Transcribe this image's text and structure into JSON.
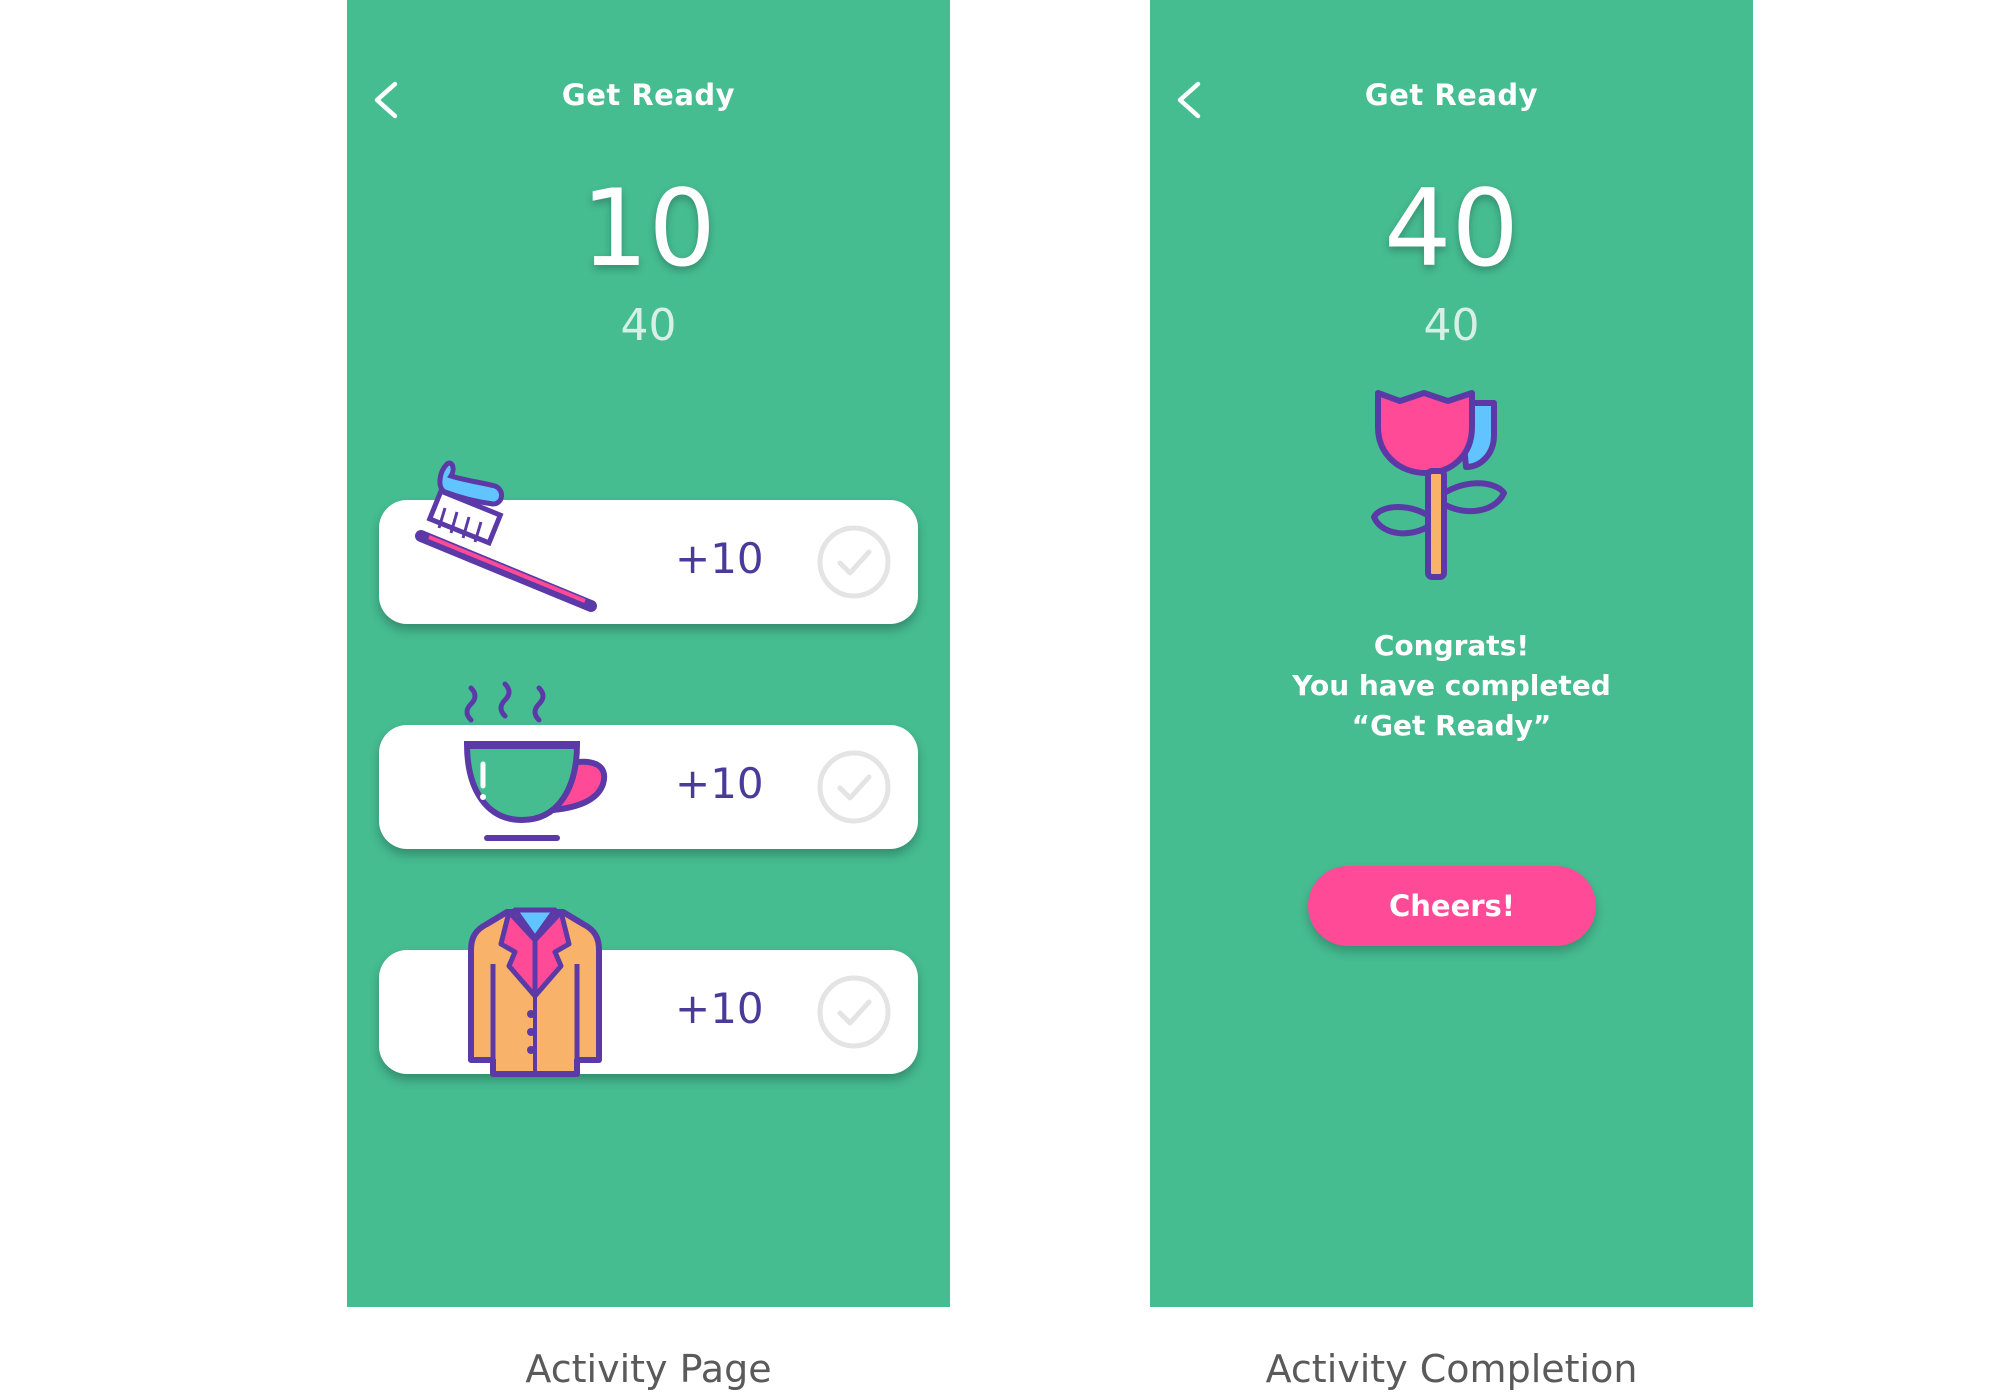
{
  "activity_page": {
    "header": {
      "title": "Get Ready",
      "back_icon": "chevron-left-icon"
    },
    "score": "10",
    "total": "40",
    "tasks": [
      {
        "icon": "toothbrush-icon",
        "points": "+10",
        "status_icon": "check-circle-icon"
      },
      {
        "icon": "coffee-cup-icon",
        "points": "+10",
        "status_icon": "check-circle-icon"
      },
      {
        "icon": "coat-icon",
        "points": "+10",
        "status_icon": "check-circle-icon"
      }
    ]
  },
  "completion_page": {
    "header": {
      "title": "Get Ready",
      "back_icon": "chevron-left-icon"
    },
    "score": "40",
    "total": "40",
    "illustration": "flower-icon",
    "message": [
      "Congrats!",
      "You have completed",
      "“Get Ready”"
    ],
    "button_label": "Cheers!"
  },
  "captions": {
    "activity": "Activity Page",
    "completion": "Activity Completion"
  },
  "colors": {
    "background": "#46bc91",
    "card": "#ffffff",
    "points_text": "#4a3a9a",
    "button": "#ff4b97",
    "icon_outline": "#5b3aa8",
    "pink": "#ff4b97",
    "light_blue": "#62c4ff",
    "orange": "#f8b26a"
  }
}
